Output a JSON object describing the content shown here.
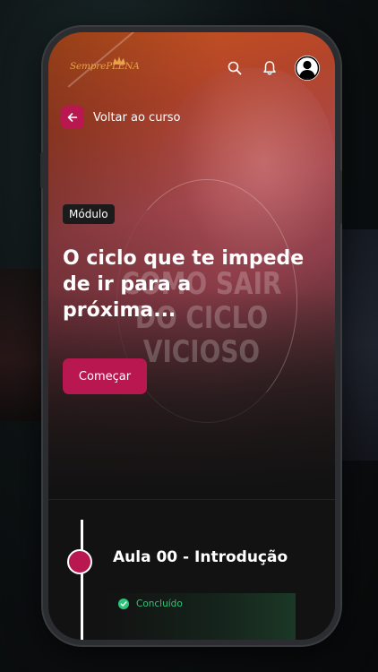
{
  "app": {
    "logo_text": "SemprePLENA"
  },
  "header": {
    "search_icon": "search-icon",
    "notifications_icon": "bell-icon",
    "profile_icon": "user-avatar-icon"
  },
  "navigation": {
    "back_label": "Voltar ao curso"
  },
  "module": {
    "badge": "Módulo",
    "title": "O ciclo que te impede de ir para a próxima...",
    "start_label": "Começar",
    "hero_watermark": "COMO SAIR DO CICLO VICIOSO"
  },
  "lesson": {
    "title": "Aula 00 - Introdução",
    "status": "Concluído"
  },
  "colors": {
    "accent": "#b8174f",
    "success": "#2ec47a",
    "logo": "#e9a24a"
  }
}
